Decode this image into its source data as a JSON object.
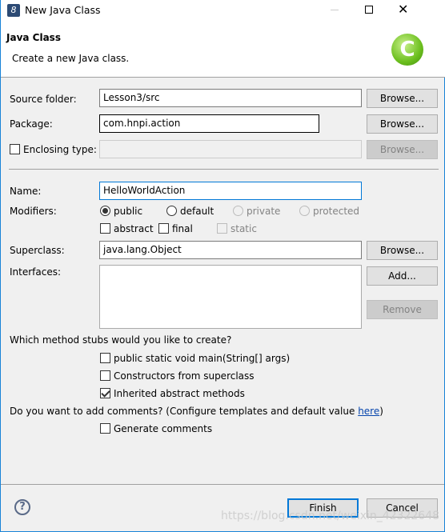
{
  "window": {
    "title": "New Java Class"
  },
  "header": {
    "title": "Java Class",
    "description": "Create a new Java class."
  },
  "form": {
    "source_folder": {
      "label": "Source folder:",
      "value": "Lesson3/src",
      "browse": "Browse..."
    },
    "package": {
      "label": "Package:",
      "value": "com.hnpi.action",
      "browse": "Browse..."
    },
    "enclosing": {
      "label": "Enclosing type:",
      "value": "",
      "browse": "Browse...",
      "checked": false
    },
    "name": {
      "label": "Name:",
      "value": "HelloWorldAction"
    },
    "modifiers": {
      "label": "Modifiers:",
      "options": [
        "public",
        "default",
        "private",
        "protected"
      ],
      "selected": "public",
      "extra": [
        {
          "label": "abstract",
          "checked": false
        },
        {
          "label": "final",
          "checked": false
        },
        {
          "label": "static",
          "checked": false,
          "disabled": true
        }
      ]
    },
    "superclass": {
      "label": "Superclass:",
      "value": "java.lang.Object",
      "browse": "Browse..."
    },
    "interfaces": {
      "label": "Interfaces:",
      "add": "Add...",
      "remove": "Remove"
    },
    "stubs": {
      "question": "Which method stubs would you like to create?",
      "items": [
        {
          "label": "public static void main(String[] args)",
          "checked": false
        },
        {
          "label": "Constructors from superclass",
          "checked": false
        },
        {
          "label": "Inherited abstract methods",
          "checked": true
        }
      ]
    },
    "comments": {
      "question": "Do you want to add comments? (Configure templates and default value ",
      "link": "here",
      "close": ")",
      "generate": {
        "label": "Generate comments",
        "checked": false
      }
    }
  },
  "footer": {
    "finish": "Finish",
    "cancel": "Cancel"
  },
  "watermark": "https://blog.csdn.net/weixin_42322648"
}
